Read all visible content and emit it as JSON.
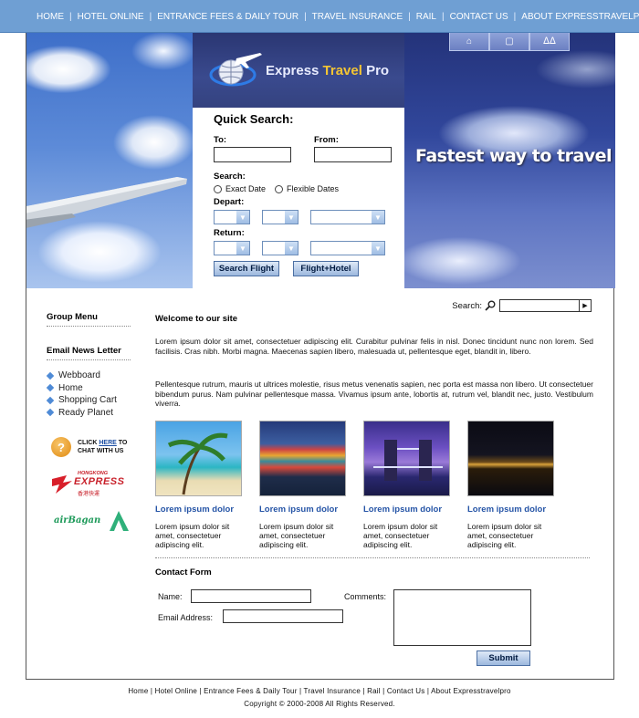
{
  "nav": {
    "items": [
      "HOME",
      "HOTEL ONLINE",
      "ENTRANCE FEES & DAILY TOUR",
      "TRAVEL INSURANCE",
      "RAIL",
      "CONTACT US",
      "ABOUT EXPRESSTRAVELPRO"
    ],
    "separator": "|"
  },
  "banner": {
    "logo": {
      "part1": "Express ",
      "part2": "Travel",
      "part3": " Pro"
    },
    "slogan": "Fastest way to travel",
    "icon_tabs": [
      "home-icon",
      "screen-icon",
      "people-icon"
    ]
  },
  "quick_search": {
    "title": "Quick Search:",
    "to_label": "To:",
    "from_label": "From:",
    "to_value": "",
    "from_value": "",
    "search_label": "Search:",
    "option_exact": "Exact Date",
    "option_flexible": "Flexible Dates",
    "depart_label": "Depart:",
    "return_label": "Return:",
    "search_flight_button": "Search Flight",
    "flight_hotel_button": "Flight+Hotel"
  },
  "sidebar": {
    "group_menu": "Group Menu",
    "newsletter": "Email News Letter",
    "links": [
      "Webboard",
      "Home",
      "Shopping Cart",
      "Ready Planet"
    ],
    "chat": {
      "line1_prefix": "CLICK ",
      "here": "HERE",
      "line1_suffix": " TO",
      "line2": "CHAT WITH US"
    },
    "hk_express": {
      "line1": "HONGKONG",
      "line2": "EXPRESS",
      "line3": "香港快運"
    },
    "air_bagan": "airBagan"
  },
  "content": {
    "search_label": "Search:",
    "search_value": "",
    "welcome": "Welcome to our site",
    "para1": "Lorem ipsum dolor sit amet, consectetuer adipiscing elit. Curabitur pulvinar felis in nisl. Donec tincidunt nunc non lorem. Sed facilisis. Cras nibh. Morbi magna. Maecenas sapien libero, malesuada ut, pellentesque eget, blandit in, libero.",
    "para2": "Pellentesque rutrum, mauris ut ultrices molestie, risus metus venenatis sapien, nec porta est massa non libero. Ut consectetuer bibendum purus. Nam pulvinar pellentesque massa. Vivamus ipsum ante, lobortis at, rutrum vel, blandit nec, justo. Vestibulum viverra.",
    "thumbs": [
      {
        "caption": "Lorem ipsum dolor",
        "desc": "Lorem ipsum dolor sit amet, consectetuer adipiscing elit."
      },
      {
        "caption": "Lorem ipsum dolor",
        "desc": "Lorem ipsum dolor sit amet, consectetuer adipiscing elit."
      },
      {
        "caption": "Lorem ipsum dolor",
        "desc": "Lorem ipsum dolor sit amet, consectetuer adipiscing elit."
      },
      {
        "caption": "Lorem ipsum dolor",
        "desc": "Lorem ipsum dolor sit amet, consectetuer adipiscing elit."
      }
    ]
  },
  "contact_form": {
    "title": "Contact Form",
    "name_label": "Name:",
    "email_label": "Email Address:",
    "comments_label": "Comments:",
    "name_value": "",
    "email_value": "",
    "comments_value": "",
    "submit": "Submit"
  },
  "footer": {
    "links": "Home  |  Hotel Online  |  Entrance Fees & Daily Tour  |  Travel Insurance  |  Rail  |  Contact Us  |  About Expresstravelpro",
    "copyright": "Copyright © 2000-2008 All Rights Reserved."
  },
  "colors": {
    "nav_bg": "#6f9fd3",
    "link_blue": "#2554a6",
    "button_bg": "#9cb8de"
  }
}
